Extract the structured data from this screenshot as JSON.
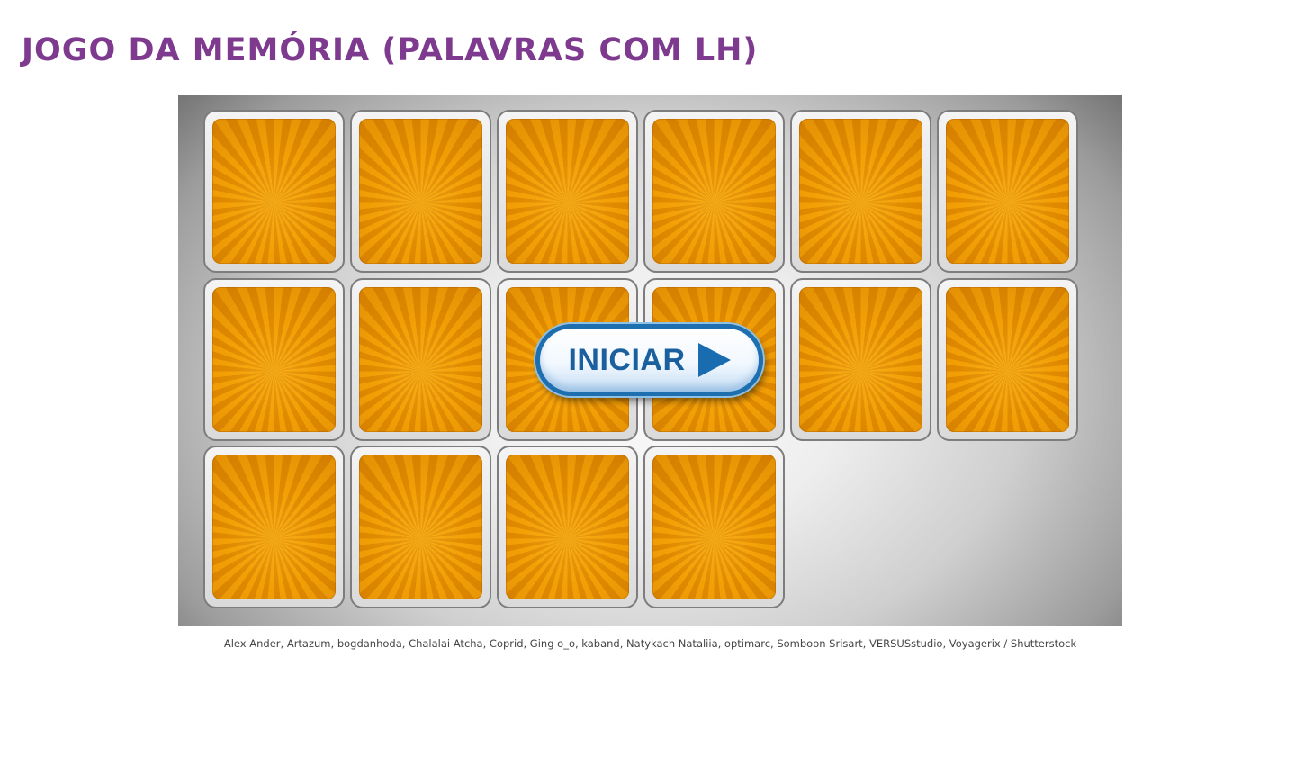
{
  "page": {
    "title": "JOGO DA MEMÓRIA (PALAVRAS COM LH)",
    "title_color": "#7e3a8e"
  },
  "game": {
    "card_count": 16,
    "card_back_colors": [
      "#f3a006",
      "#e08a00"
    ],
    "start_button": {
      "label": "INICIAR",
      "icon": "play-icon",
      "color": "#1a5f9e"
    }
  },
  "credits": "Alex Ander, Artazum, bogdanhoda, Chalalai Atcha, Coprid, Ging o_o, kaband, Natykach Nataliia, optimarc, Somboon Srisart, VERSUSstudio, Voyagerix / Shutterstock"
}
